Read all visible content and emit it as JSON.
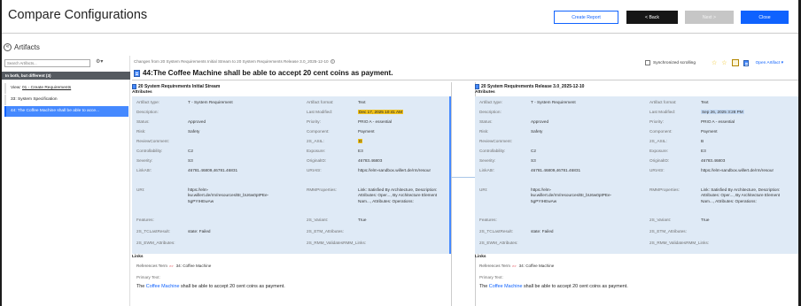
{
  "header": {
    "title": "Compare Configurations",
    "create_report": "Create Report",
    "back": "< Back",
    "next": "Next >",
    "close": "Close"
  },
  "artifacts_label": "Artifacts",
  "sidebar": {
    "search_placeholder": "Search Artifacts...",
    "group": "In both, but different (3)",
    "items": [
      {
        "prefix": "View:",
        "label": "01 - Create Requirements"
      },
      {
        "label": "33: System Specification"
      },
      {
        "label": "44: The Coffee Machine shall be able to acce..."
      }
    ]
  },
  "compare_header": "Changes from 20 System Requirements Initial Stream to 20 System Requirements Release 3.0_2025-12-10",
  "artifact_title": "44:The Coffee Machine shall be able to accept 20 cent coins as payment.",
  "sync_label": "Synchronized scrolling",
  "open_artifact": "Open Artifact",
  "section_attributes": "Attributes",
  "section_links": "Links",
  "left": {
    "stream": "20 System Requirements Initial Stream",
    "artifact_type": "T - System Requirement",
    "artifact_format": "Text",
    "description": "",
    "last_modified": "Dec 17, 2025 10:41 AM",
    "status": "Approved",
    "priority": "PRIO A - essential",
    "risk": "Safety",
    "component": "Payment",
    "review_comment": "",
    "asil": "D",
    "controllability": "C2",
    "exposure": "E3",
    "severity": "S3",
    "original_id": "46783.46803",
    "link_attr": "46781.46809,46781.46831",
    "uri_attr": "https://elm-sandbox.willert.de/rm/resour",
    "uri": "https://elm-kw.willert.de/rm/resources/BI_bU6w0ptPEe-5gPYIHEwAw",
    "rmm_properties": "Link: Satisfied By Architecture, Description: Attributes: Oper..., By Architecture Element Nam..., Attributes: Operations:",
    "features": "",
    "variant": "True",
    "tc_last_result": "state: Failed",
    "etm_attributes": "",
    "ewm_attributes": "",
    "rmm_validates": "",
    "ref_label": "References Term",
    "ref_value": "34: Coffee Machine",
    "primary_label": "Primary Text:",
    "primary_pre": "The",
    "primary_link": "Coffee Machine",
    "primary_post": "shall be able to accept 20 cent coins as payment."
  },
  "right": {
    "stream": "20 System Requirements Release 3.0_2025-12-10",
    "artifact_type": "T - System Requirement",
    "artifact_format": "Text",
    "description": "",
    "last_modified": "Sep 26, 2025 3:28 PM",
    "status": "Approved",
    "priority": "PRIO A - essential",
    "risk": "Safety",
    "component": "Payment",
    "review_comment": "",
    "asil": "B",
    "controllability": "C2",
    "exposure": "E3",
    "severity": "S3",
    "original_id": "46783.46803",
    "link_attr": "46781.46809,46781.46831",
    "uri_attr": "https://elm-sandbox.willert.de/rm/resour",
    "uri": "https://elm-kw.willert.de/rm/resources/BI_bU6w0ptPEe-5gPYIHEwAw",
    "rmm_properties": "Link: Satisfied By Architecture, Description: Attributes: Oper..., By Architecture Element Nam..., Attributes: Operations:",
    "features": "",
    "variant": "True",
    "tc_last_result": "state: Failed",
    "etm_attributes": "",
    "ewm_attributes": "",
    "rmm_validates": "",
    "ref_label": "References Term",
    "ref_value": "34: Coffee Machine",
    "primary_label": "Primary Text:",
    "primary_pre": "The",
    "primary_link": "Coffee Machine",
    "primary_post": "shall be able to accept 20 cent coins as payment."
  },
  "labels": {
    "artifact_type": "Artifact type:",
    "artifact_format": "Artifact format:",
    "description": "Description:",
    "last_modified": "Last Modified:",
    "status": "Status:",
    "priority": "Priority:",
    "risk": "Risk:",
    "component": "Component:",
    "review_comment": "ReviewComment:",
    "asil": "2S_ASIL:",
    "controllability": "Controllability:",
    "exposure": "Exposure:",
    "severity": "Severity:",
    "original_id": "OriginalID:",
    "link_attr": "LinkAttr:",
    "uri_attr": "URIAttr:",
    "uri": "URI:",
    "rmm_properties": "RMMProperties:",
    "features": "Features:",
    "variant": "2S_Variant:",
    "tc_last_result": "2S_TCLastResult:",
    "etm_attributes": "2S_ETM_Attributes:",
    "ewm_attributes": "2S_EWM_Attributes:",
    "rmm_validates": "2S_RMM_ValidatesRMM_Links:"
  }
}
